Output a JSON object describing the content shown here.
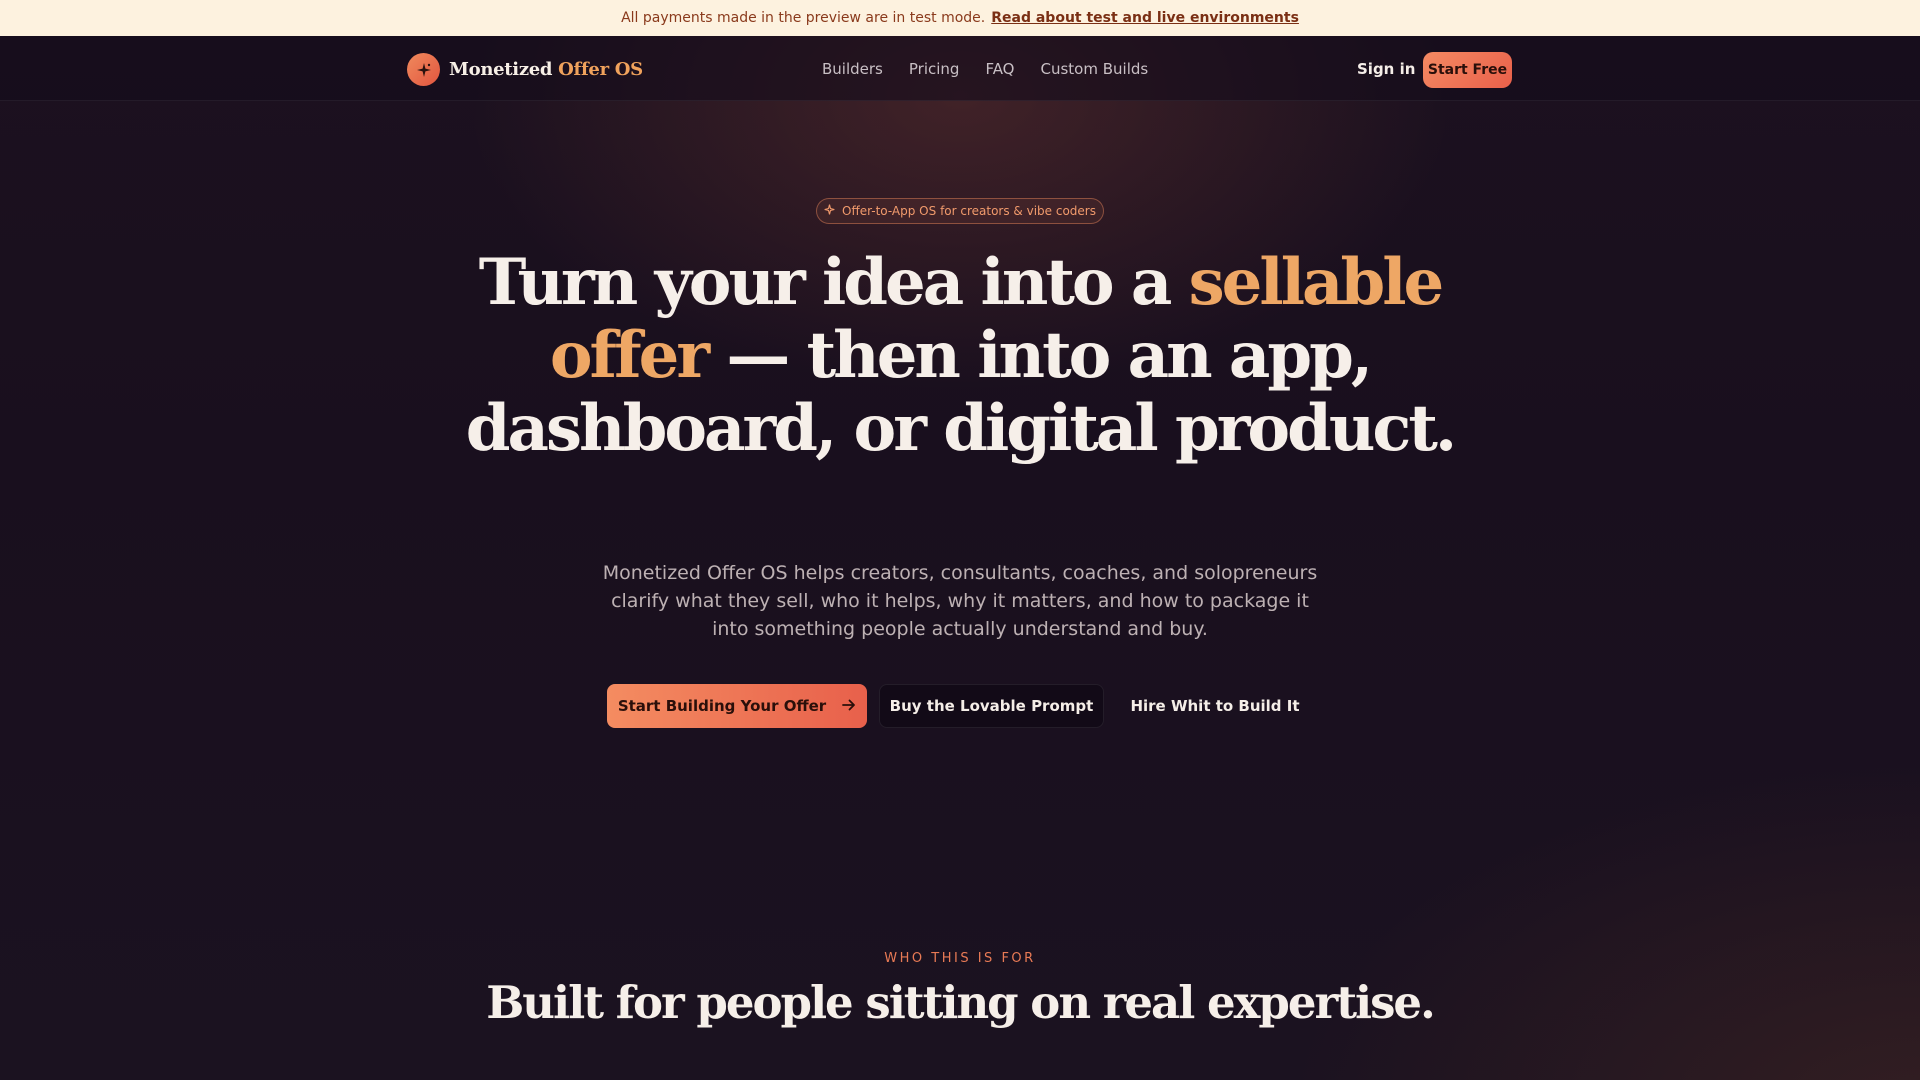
{
  "banner": {
    "text": "All payments made in the preview are in test mode.",
    "link": "Read about test and live environments"
  },
  "brand": {
    "name_part1": "Monetized",
    "name_part2": "Offer OS",
    "logo_icon": "sparkle-icon"
  },
  "nav": {
    "links": [
      "Builders",
      "Pricing",
      "FAQ",
      "Custom Builds"
    ],
    "sign_in": "Sign in",
    "start_free": "Start Free"
  },
  "hero": {
    "pill": "Offer-to-App OS for creators & vibe coders",
    "title_part1": "Turn your idea into a ",
    "title_highlight": "sellable offer",
    "title_part2": " — then into an app, dashboard, or digital product.",
    "subtitle": "Monetized Offer OS helps creators, consultants, coaches, and solopreneurs clarify what they sell, who it helps, why it matters, and how to package it into something people actually understand and buy.",
    "cta_primary": "Start Building Your Offer",
    "cta_secondary": "Buy the Lovable Prompt",
    "cta_tertiary": "Hire Whit to Build It"
  },
  "section": {
    "eyebrow": "WHO THIS IS FOR",
    "title": "Built for people sitting on real expertise."
  },
  "colors": {
    "accent": "#f0875f",
    "highlight": "#eea765",
    "background": "#170e1e",
    "banner_bg": "#fdf2df"
  }
}
